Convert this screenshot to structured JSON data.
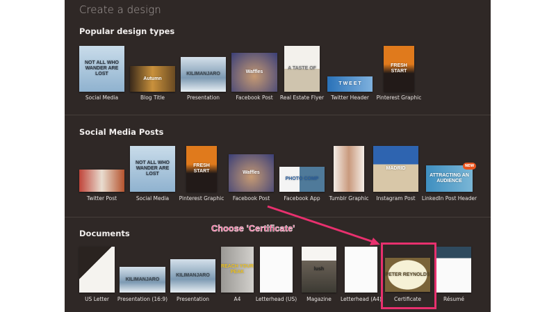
{
  "header": {
    "title": "Create a design"
  },
  "annotation": {
    "text": "Choose 'Certificate'",
    "color": "#e8306e"
  },
  "sections": [
    {
      "title": "Popular design types",
      "items": [
        {
          "label": "Social Media",
          "bg": "linear-gradient(#c9dcea,#8fb2cf)",
          "text": "NOT ALL WHO WANDER ARE LOST",
          "tc": "#2a3440"
        },
        {
          "label": "Blog Title",
          "bg": "linear-gradient(90deg,#3a2a1a,#c9913c,#6a4a22)",
          "text": "Autumn",
          "tc": "#fff"
        },
        {
          "label": "Presentation",
          "bg": "linear-gradient(#d4e0ea,#7d9ab3 60%,#e7eef3)",
          "text": "KILIMANJARO",
          "tc": "#3a4650"
        },
        {
          "label": "Facebook Post",
          "bg": "radial-gradient(circle at 50% 60%,#c69a73,#3a3f78)",
          "text": "Waffles",
          "tc": "#fff"
        },
        {
          "label": "Real Estate Flyer",
          "bg": "linear-gradient(#f3f1ec 50%,#cfc4ae 50%)",
          "text": "A TASTE OF",
          "tc": "#777"
        },
        {
          "label": "Twitter Header",
          "bg": "linear-gradient(90deg,#2a72b8,#7fb1de)",
          "text": "T W E E T",
          "tc": "#fff"
        },
        {
          "label": "Pinterest Graphic",
          "bg": "linear-gradient(#e07a1c 40%,#221a18 60%)",
          "text": "FRESH START",
          "tc": "#fff"
        }
      ]
    },
    {
      "title": "Social Media Posts",
      "items": [
        {
          "label": "Twitter Post",
          "bg": "linear-gradient(90deg,#c0453a,#e9ddd0,#b5532e)",
          "text": "",
          "tc": "#fff"
        },
        {
          "label": "Social Media",
          "bg": "linear-gradient(#c9dcea,#8fb2cf)",
          "text": "NOT ALL WHO WANDER ARE LOST",
          "tc": "#2a3440"
        },
        {
          "label": "Pinterest Graphic",
          "bg": "linear-gradient(#e07a1c 40%,#221a18 60%)",
          "text": "FRESH START",
          "tc": "#fff"
        },
        {
          "label": "Facebook Post",
          "bg": "radial-gradient(circle at 50% 60%,#c69a73,#3a3f78)",
          "text": "Waffles",
          "tc": "#fff"
        },
        {
          "label": "Facebook App",
          "bg": "linear-gradient(90deg,#f4f4f4 45%,#4f7a9a 45%)",
          "text": "PHOTO COMP",
          "tc": "#2a5fa0"
        },
        {
          "label": "Tumblr Graphic",
          "bg": "linear-gradient(90deg,#f4ede6,#c99a7e,#f4ede6)",
          "text": "",
          "tc": "#fff"
        },
        {
          "label": "Instagram Post",
          "bg": "linear-gradient(#2e64b0 40%,#d8c7a8 40%)",
          "text": "MADRID",
          "tc": "#fff"
        },
        {
          "label": "LinkedIn Post Header",
          "bg": "linear-gradient(90deg,#3f8fc0,#7ab6d6)",
          "text": "ATTRACTING AN AUDIENCE",
          "tc": "#fff",
          "badge": "NEW"
        }
      ]
    },
    {
      "title": "Documents",
      "items": [
        {
          "label": "US Letter",
          "bg": "linear-gradient(135deg,#2a2320 40%,#f5f3ef 40%)",
          "text": "",
          "tc": "#fff"
        },
        {
          "label": "Presentation (16:9)",
          "bg": "linear-gradient(#d4e0ea,#7d9ab3 60%,#e7eef3)",
          "text": "KILIMANJARO",
          "tc": "#3a4650"
        },
        {
          "label": "Presentation",
          "bg": "linear-gradient(#d4e0ea,#7d9ab3 60%,#e7eef3)",
          "text": "KILIMANJARO",
          "tc": "#3a4650"
        },
        {
          "label": "A4",
          "bg": "linear-gradient(90deg,#9a9894,#d2d0cc)",
          "text": "REACH YOUR PEAK",
          "tc": "#f0c420"
        },
        {
          "label": "Letterhead (US)",
          "bg": "#fbfbfb",
          "text": "",
          "tc": "#333"
        },
        {
          "label": "Magazine",
          "bg": "linear-gradient(#f7f5f2 30%,#6b6257 30%,#3c3a33)",
          "text": "lush",
          "tc": "#222"
        },
        {
          "label": "Letterhead (A4)",
          "bg": "#fbfbfb",
          "text": "",
          "tc": "#333"
        },
        {
          "label": "Certificate",
          "bg": "radial-gradient(#f6f1d6 60%,#7a6338 62%)",
          "text": "PETER REYNOLDS",
          "tc": "#5a4a2a"
        },
        {
          "label": "Résumé",
          "bg": "linear-gradient(#2f4a5e 25%,#fafafa 25%)",
          "text": "",
          "tc": "#fff"
        }
      ]
    }
  ]
}
